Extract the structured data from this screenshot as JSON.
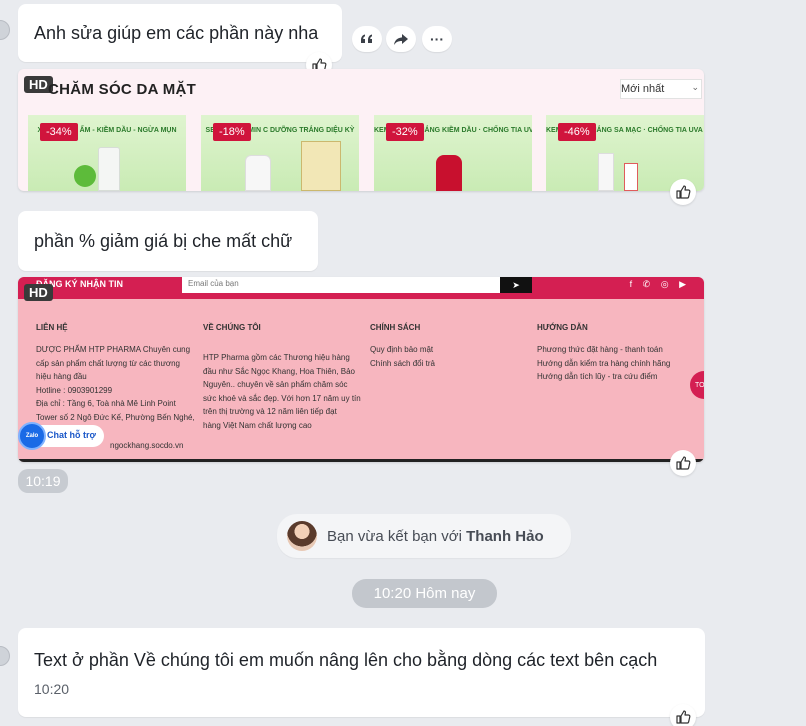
{
  "messages": [
    {
      "text": "Anh sửa giúp em các phần này nha"
    },
    {
      "text": "phần % giảm giá bị che mất chữ"
    },
    {
      "text": "Text ở phần Về chúng tôi em muốn nâng lên cho bằng dòng các text bên cạch",
      "time": "10:20"
    }
  ],
  "actions": {
    "quote_icon": "quote-icon",
    "forward_icon": "share-icon",
    "more_label": "···"
  },
  "image1": {
    "hd": "HD",
    "title": "CHĂM SÓC DA MẶT",
    "sort_value": "Mới nhất",
    "sort_caret": "⌄",
    "products": [
      {
        "discount": "-34%",
        "label": "XỊT DƯỠNG ẨM - KIỀM DẦU - NGỪA MỤN"
      },
      {
        "discount": "-18%",
        "label": "SERUM VITAMIN C DƯỠNG TRẮNG DIỆU KỲ"
      },
      {
        "discount": "-32%",
        "label": "KEM CHỐNG NẮNG KIỀM DẦU · CHỐNG TIA UVA - UVB - ÁNH SÁNG XANH"
      },
      {
        "discount": "-46%",
        "label": "KEM CHỐNG NẮNG SA MẠC · CHỐNG TIA UVA - UVB - ÁNH SÁNG XANH"
      }
    ]
  },
  "image2": {
    "hd": "HD",
    "newsletter": "ĐĂNG KÝ NHẬN TIN",
    "email_placeholder": "Email của bạn",
    "send_icon": "➤",
    "socials": "f ✆ ◎ ▶",
    "columns": [
      {
        "heading": "LIÊN HỆ",
        "lines": [
          "DƯỢC PHẨM HTP PHARMA Chuyên cung",
          "cấp sản phẩm chất lượng từ các thương",
          "hiệu hàng đầu",
          "Hotline : 0903901299",
          "Địa chỉ : Tầng 6, Toà nhà Mê Linh Point",
          "Tower số 2 Ngô Đức Kế, Phường Bến Nghé,"
        ]
      },
      {
        "heading": "VỀ CHÚNG TÔI",
        "lines": [
          "HTP Pharma gồm các Thương hiệu hàng",
          "đầu như Sắc Ngọc Khang, Hoa Thiên, Bảo",
          "Nguyên.. chuyên về sản phẩm chăm sóc",
          "sức khoẻ và sắc đẹp. Với hơn 17 năm uy tín",
          "trên thị trường và 12 năm liên tiếp đạt",
          "hàng Việt Nam chất lượng cao"
        ]
      },
      {
        "heading": "CHÍNH SÁCH",
        "lines": [
          "Quy định bảo mật",
          "Chính sách đổi trả"
        ]
      },
      {
        "heading": "HƯỚNG DẪN",
        "lines": [
          "Phương thức đặt hàng - thanh toán",
          "Hướng dẫn kiểm tra hàng chính hãng",
          "Hướng dẫn tích lũy - tra cứu điểm"
        ]
      }
    ],
    "zalo_label": "Zalo",
    "support_label": "Chat hỗ trợ",
    "website_fragment": "ngockhang.socdo.vn",
    "side_button": "TOP"
  },
  "time_1019": "10:19",
  "notice": {
    "prefix": "Bạn vừa kết bạn với ",
    "name": "Thanh Hảo"
  },
  "date_divider": "10:20 Hôm nay",
  "colors": {
    "bg": "#e9ebef",
    "bubble": "#ffffff",
    "brand_red": "#d41f52",
    "footer_pink": "#f7b6bf"
  }
}
